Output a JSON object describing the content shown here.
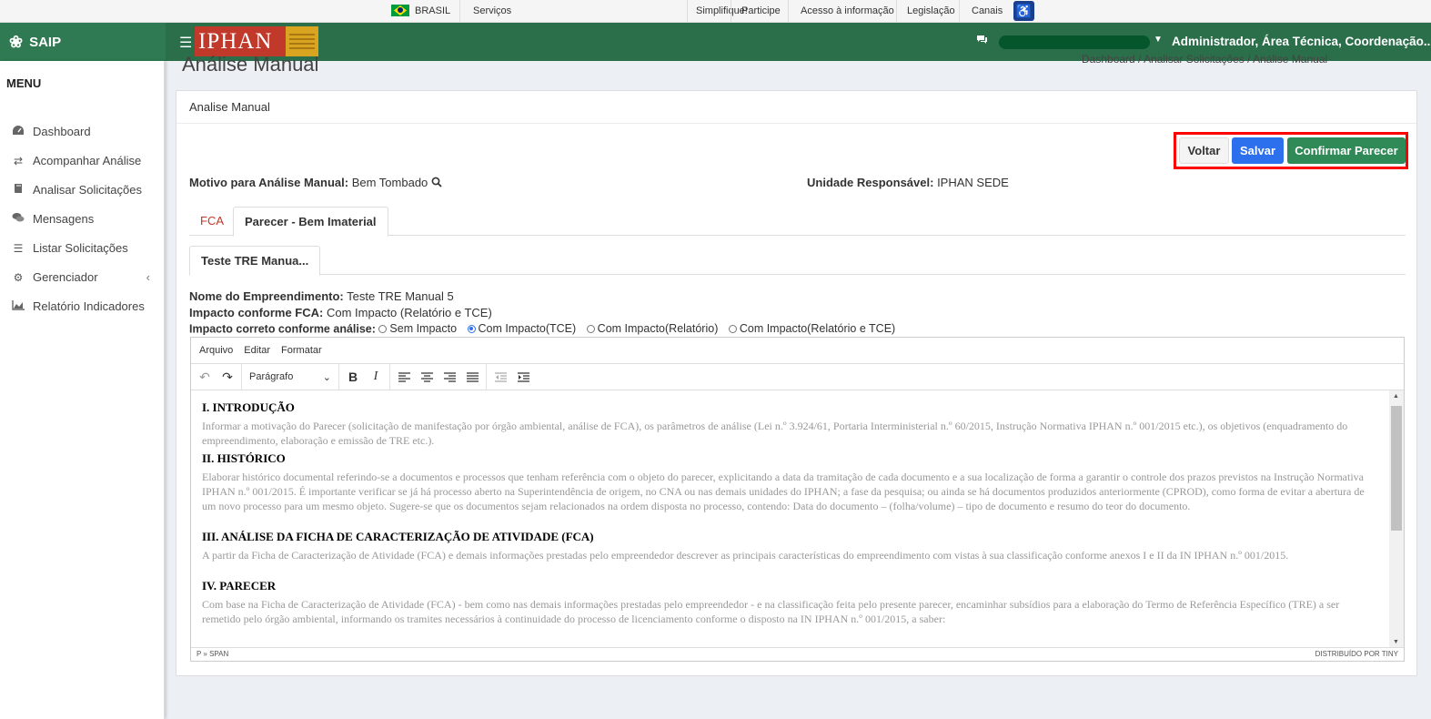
{
  "govbar": {
    "country": "BRASIL",
    "links": [
      "Serviços",
      "Simplifique!",
      "Participe",
      "Acesso à informação",
      "Legislação",
      "Canais"
    ]
  },
  "header": {
    "app_name": "SAIP",
    "logo_text": "IPHAN",
    "user_roles": "Administrador, Área Técnica, Coordenação..."
  },
  "sidebar": {
    "title": "MENU",
    "items": [
      {
        "label": "Dashboard",
        "icon": "dashboard-icon"
      },
      {
        "label": "Acompanhar Análise",
        "icon": "exchange-icon"
      },
      {
        "label": "Analisar Solicitações",
        "icon": "book-icon"
      },
      {
        "label": "Mensagens",
        "icon": "comments-icon"
      },
      {
        "label": "Listar Solicitações",
        "icon": "list-icon"
      },
      {
        "label": "Gerenciador",
        "icon": "cogs-icon"
      },
      {
        "label": "Relatório Indicadores",
        "icon": "area-chart-icon"
      }
    ]
  },
  "page": {
    "heading": "Análise Manual",
    "breadcrumb": [
      "Dashboard",
      "Analisar Solicitações",
      "Análise Manual"
    ]
  },
  "card": {
    "title": "Analise Manual",
    "buttons": {
      "voltar": "Voltar",
      "salvar": "Salvar",
      "confirmar": "Confirmar Parecer"
    },
    "motivo_label": "Motivo para Análise Manual:",
    "motivo_value": "Bem Tombado",
    "unidade_label": "Unidade Responsável:",
    "unidade_value": "IPHAN SEDE",
    "tabs": [
      "FCA",
      "Parecer - Bem Imaterial"
    ],
    "subtab": "Teste TRE Manua...",
    "nome_label": "Nome do Empreendimento:",
    "nome_value": "Teste TRE Manual 5",
    "impacto_fca_label": "Impacto conforme FCA:",
    "impacto_fca_value": "Com Impacto (Relatório e TCE)",
    "impacto_correto_label": "Impacto correto conforme análise:",
    "radio_options": [
      "Sem Impacto",
      "Com Impacto(TCE)",
      "Com Impacto(Relatório)",
      "Com Impacto(Relatório e TCE)"
    ],
    "radio_selected": "Com Impacto(TCE)"
  },
  "editor": {
    "menu": [
      "Arquivo",
      "Editar",
      "Formatar"
    ],
    "format_select": "Parágrafo",
    "sections": [
      {
        "heading": "I. INTRODUÇÃO",
        "paragraphs": [
          "Informar a motivação do Parecer (solicitação de manifestação por órgão ambiental, análise de FCA), os parâmetros de análise (Lei n.º 3.924/61, Portaria Interministerial n.º 60/2015, Instrução Normativa IPHAN n.º 001/2015 etc.), os objetivos (enquadramento do empreendimento, elaboração e emissão de TRE etc.)."
        ]
      },
      {
        "heading": "II. HISTÓRICO",
        "paragraphs": [
          "Elaborar histórico documental referindo-se a documentos e processos que tenham referência com o objeto do parecer, explicitando a data da tramitação de cada documento e a sua localização de forma a garantir o controle dos prazos previstos na Instrução Normativa IPHAN n.º 001/2015. É importante verificar se já há processo aberto na Superintendência de origem, no CNA ou nas demais unidades do IPHAN; a fase da pesquisa; ou ainda se há documentos produzidos anteriormente (CPROD), como forma de evitar a abertura de um novo processo para um mesmo objeto. Sugere-se que os documentos sejam relacionados na ordem disposta no processo, contendo: Data do documento – (folha/volume) – tipo de documento e resumo do teor do documento."
        ]
      },
      {
        "heading": "III. ANÁLISE DA FICHA DE CARACTERIZAÇÃO DE ATIVIDADE (FCA)",
        "paragraphs": [
          "A partir da Ficha de Caracterização de Atividade (FCA) e demais informações prestadas pelo empreendedor descrever as principais características do empreendimento com vistas à sua classificação conforme anexos I e II da IN IPHAN n.º 001/2015."
        ]
      },
      {
        "heading": "IV. PARECER",
        "paragraphs": [
          "Com base na Ficha de Caracterização de Atividade (FCA) - bem como nas demais informações prestadas pelo empreendedor - e na classificação feita pelo presente parecer, encaminhar subsídios para a elaboração do Termo de Referência Específico (TRE) a ser remetido pelo órgão ambiental, informando os tramites necessários à continuidade do processo de licenciamento conforme o disposto na IN IPHAN n.º 001/2015, a saber:"
        ]
      }
    ],
    "status_path": "P » SPAN",
    "powered_by": "DISTRIBUÍDO POR TINY"
  },
  "colors": {
    "header_bg": "#2a6e4a",
    "brand_bg": "#2f7a52",
    "salvar": "#2d70ee",
    "confirmar": "#2f8a57",
    "highlight_border": "#ff0000",
    "fca_tab": "#c0392b"
  }
}
